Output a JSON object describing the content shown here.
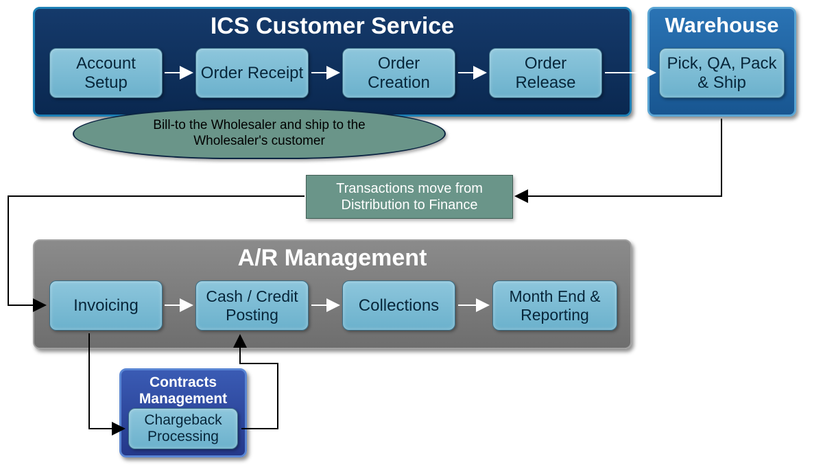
{
  "containers": {
    "customer_service": {
      "title": "ICS Customer Service"
    },
    "warehouse": {
      "title": "Warehouse"
    },
    "ar_management": {
      "title": "A/R Management"
    },
    "contracts": {
      "title": "Contracts Management"
    }
  },
  "steps": {
    "account_setup": "Account Setup",
    "order_receipt": "Order Receipt",
    "order_creation": "Order Creation",
    "order_release": "Order Release",
    "pick_qa_pack_ship": "Pick, QA, Pack & Ship",
    "invoicing": "Invoicing",
    "cash_credit_posting": "Cash / Credit Posting",
    "collections": "Collections",
    "month_end_reporting": "Month End & Reporting",
    "chargeback_processing": "Chargeback Processing"
  },
  "notes": {
    "bill_ship": "Bill-to the Wholesaler and ship to the Wholesaler's customer",
    "transition": "Transactions move from Distribution to Finance"
  },
  "colors": {
    "dark_navy": "#0f3360",
    "mid_blue": "#2366a8",
    "gray_panel": "#7d7d7d",
    "blue_panel": "#2f4fa8",
    "step_fill": "#7dbcd4"
  }
}
